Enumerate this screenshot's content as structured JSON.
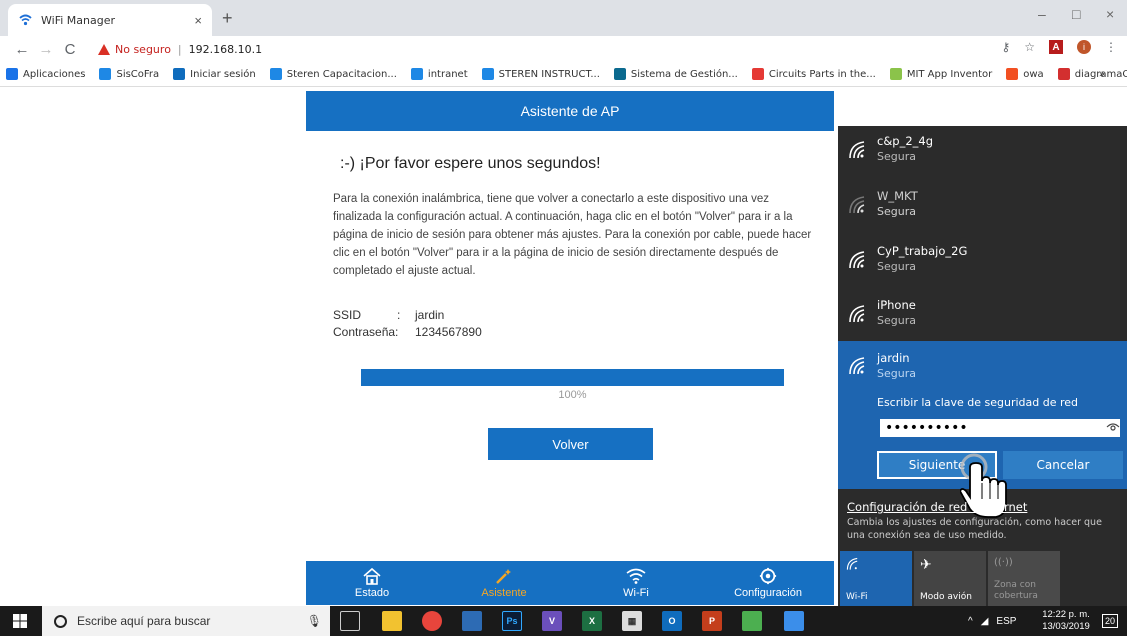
{
  "browser": {
    "tab_title": "WiFi Manager",
    "tab_close": "×",
    "new_tab": "+",
    "win_min": "–",
    "win_max": "□",
    "win_close": "×",
    "security_label": "No seguro",
    "url": "192.168.10.1",
    "bookmarks": [
      {
        "label": "Aplicaciones",
        "icon": "apps-grid-icon",
        "color": "#1a73e8"
      },
      {
        "label": "SisCoFra",
        "icon": "swirl-icon",
        "color": "#1e88e5"
      },
      {
        "label": "Iniciar sesión",
        "icon": "outlook-icon",
        "color": "#0f6cbd"
      },
      {
        "label": "Steren Capacitacion...",
        "icon": "swirl-icon",
        "color": "#1e88e5"
      },
      {
        "label": "intranet",
        "icon": "swirl-icon",
        "color": "#1e88e5"
      },
      {
        "label": "STEREN INSTRUCT...",
        "icon": "swirl-icon",
        "color": "#1e88e5"
      },
      {
        "label": "Sistema de Gestión...",
        "icon": "sharepoint-icon",
        "color": "#0b6a8f"
      },
      {
        "label": "Circuits Parts in the...",
        "icon": "colorful-grid-icon",
        "color": "#e53935"
      },
      {
        "label": "MIT App Inventor",
        "icon": "mit-icon",
        "color": "#8bc34a"
      },
      {
        "label": "owa",
        "icon": "ms-logo-icon",
        "color": "#f25022"
      },
      {
        "label": "diagramaOnline",
        "icon": "diagram-icon",
        "color": "#d32f2f"
      }
    ],
    "bookmarks_more": "»"
  },
  "page": {
    "header": "Asistente de AP",
    "wait_title": ":-) ¡Por favor espere unos segundos!",
    "description": "Para la conexión inalámbrica, tiene que volver a conectarlo a este dispositivo una vez finalizada la configuración actual. A continuación, haga clic en el botón \"Volver\" para ir a la página de inicio de sesión para obtener más ajustes. Para la conexión por cable, puede hacer clic en el botón \"Volver\" para ir a la página de inicio de sesión directamente después de completado el ajuste actual.",
    "ssid_label": "SSID",
    "ssid_value": "jardin",
    "password_label": "Contraseña:",
    "password_value": "1234567890",
    "progress_percent": 100,
    "progress_text": "100%",
    "back_button": "Volver",
    "nav": [
      {
        "label": "Estado",
        "icon": "home-icon",
        "active": false
      },
      {
        "label": "Asistente",
        "icon": "wand-icon",
        "active": true
      },
      {
        "label": "Wi-Fi",
        "icon": "wifi-icon",
        "active": false
      },
      {
        "label": "Configuración",
        "icon": "gear-icon",
        "active": false
      }
    ],
    "accent_color": "#1670c2",
    "active_color": "#f5a623"
  },
  "flyout": {
    "networks": [
      {
        "name": "c&p_2_4g",
        "status": "Segura"
      },
      {
        "name": "W_MKT",
        "status": "Segura"
      },
      {
        "name": "CyP_trabajo_2G",
        "status": "Segura"
      },
      {
        "name": "iPhone",
        "status": "Segura"
      }
    ],
    "selected": {
      "name": "jardin",
      "status": "Segura",
      "key_label": "Escribir la clave de seguridad de red",
      "key_value": "••••••••••",
      "next_button": "Siguiente",
      "cancel_button": "Cancelar"
    },
    "settings_link": "Configuración de red e Internet",
    "settings_desc": "Cambia los ajustes de configuración, como hacer que una conexión sea de uso medido.",
    "quick_actions": [
      {
        "label": "Wi-Fi",
        "icon": "wifi-icon"
      },
      {
        "label": "Modo avión",
        "icon": "airplane-icon"
      },
      {
        "label": "Zona con cobertura",
        "icon": "hotspot-icon"
      }
    ]
  },
  "taskbar": {
    "search_placeholder": "Escribe aquí para buscar",
    "language": "ESP",
    "time": "12:22 p. m.",
    "date": "13/03/2019",
    "notifications": "20"
  }
}
